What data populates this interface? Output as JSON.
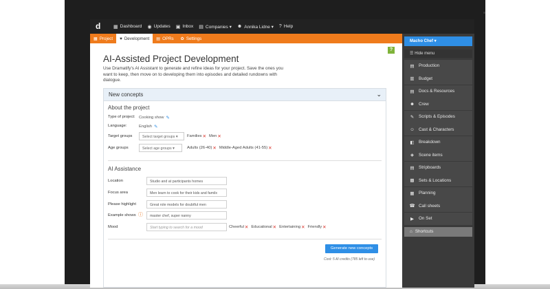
{
  "topbar": {
    "logo": "d",
    "nav": [
      {
        "icon": "dashboard-icon",
        "glyph": "▦",
        "label": "Dashboard"
      },
      {
        "icon": "updates-icon",
        "glyph": "◉",
        "label": "Updates"
      },
      {
        "icon": "inbox-icon",
        "glyph": "▣",
        "label": "Inbox"
      },
      {
        "icon": "companies-icon",
        "glyph": "▤",
        "label": "Companies ▾"
      },
      {
        "icon": "user-icon",
        "glyph": "☻",
        "label": "Annika Lidne ▾"
      },
      {
        "icon": "help-icon",
        "glyph": "?",
        "label": "Help"
      }
    ]
  },
  "tabs": [
    {
      "icon": "project-icon",
      "glyph": "▦",
      "label": "Project"
    },
    {
      "icon": "development-icon",
      "glyph": "♥",
      "label": "Development"
    },
    {
      "icon": "oprs-icon",
      "glyph": "▤",
      "label": "OPRs"
    },
    {
      "icon": "settings-icon",
      "glyph": "✿",
      "label": "Settings"
    }
  ],
  "help_badge": "?",
  "page": {
    "title": "AI-Assisted Project Development",
    "intro": "Use Dramatify's AI Assistant to generate and refine ideas for your project. Save the ones you want to keep, then move on to developing them into episodes and detailed rundowns with dialogue."
  },
  "panel": {
    "title": "New concepts",
    "about": {
      "title": "About the project",
      "type_label": "Type of project:",
      "type_value": "Cooking show",
      "language_label": "Language:",
      "language_value": "English",
      "target_label": "Target groups",
      "target_placeholder": "Select target groups ▾",
      "target_tags": [
        "Families",
        "Men"
      ],
      "age_label": "Age groups",
      "age_placeholder": "Select age groups ▾",
      "age_tags": [
        "Adults (26-40)",
        "Middle-Aged Adults (41-55)"
      ]
    },
    "ai": {
      "title": "AI Assistance",
      "location_label": "Location",
      "location_value": "Studio and at participants homes",
      "focus_label": "Focus area",
      "focus_value": "Men learn to cook for their kids and familx",
      "highlight_label": "Please highlight",
      "highlight_value": "Great role models for doubtful men",
      "example_label": "Example shows",
      "example_value": "master chef, super nanny",
      "mood_label": "Mood",
      "mood_placeholder": "Start typing to search for a mood",
      "mood_tags": [
        "Cheerful",
        "Educational",
        "Entertaining",
        "Friendly"
      ]
    },
    "generate_label": "Generate new concepts",
    "cost": "Cost: 5 AI credits (785 left to use)"
  },
  "sidebar": {
    "user_button": "Macho Chef ▾",
    "hide_menu": "Hide menu",
    "items": [
      {
        "icon": "production-icon",
        "glyph": "▤",
        "label": "Production"
      },
      {
        "icon": "budget-icon",
        "glyph": "▥",
        "label": "Budget"
      },
      {
        "icon": "docs-icon",
        "glyph": "▤",
        "label": "Docs & Resources"
      },
      {
        "icon": "crew-icon",
        "glyph": "☻",
        "label": "Crew"
      },
      {
        "icon": "scripts-icon",
        "glyph": "✎",
        "label": "Scripts & Episodes"
      },
      {
        "icon": "cast-icon",
        "glyph": "☺",
        "label": "Cast & Characters"
      },
      {
        "icon": "breakdown-icon",
        "glyph": "◧",
        "label": "Breakdown"
      },
      {
        "icon": "scene-items-icon",
        "glyph": "◈",
        "label": "Scene items"
      },
      {
        "icon": "stripboards-icon",
        "glyph": "▤",
        "label": "Stripboards"
      },
      {
        "icon": "sets-icon",
        "glyph": "▩",
        "label": "Sets & Locations"
      },
      {
        "icon": "planning-icon",
        "glyph": "▦",
        "label": "Planning"
      },
      {
        "icon": "call-sheets-icon",
        "glyph": "☎",
        "label": "Call sheets"
      },
      {
        "icon": "on-set-icon",
        "glyph": "▶",
        "label": "On Set"
      }
    ],
    "shortcuts": "Shortcuts"
  }
}
